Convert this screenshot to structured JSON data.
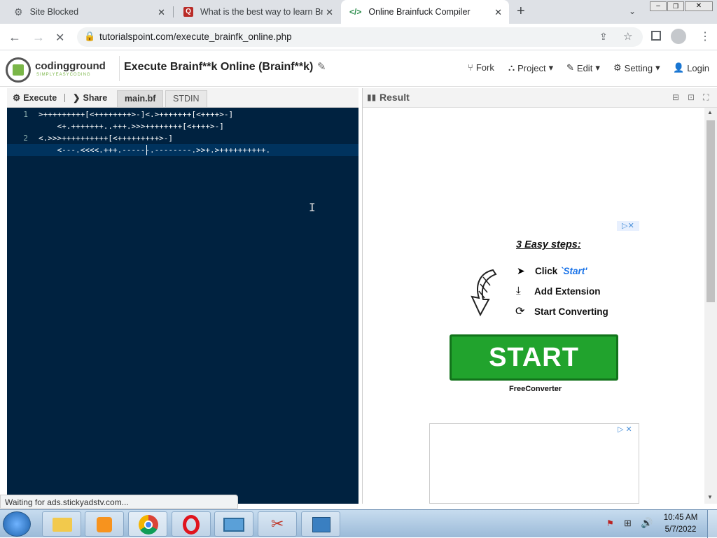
{
  "browser": {
    "tabs": [
      {
        "title": "Site Blocked",
        "icon": "gear-icon"
      },
      {
        "title": "What is the best way to learn Bra",
        "icon": "quora-icon"
      },
      {
        "title": "Online Brainfuck Compiler",
        "icon": "code-icon"
      }
    ],
    "url": "tutorialspoint.com/execute_brainfk_online.php"
  },
  "site": {
    "logo_text": "codingground",
    "logo_tagline": "SIMPLYEASYCODING",
    "page_title": "Execute Brainf**k Online (Brainf**k)",
    "menu": {
      "fork": "Fork",
      "project": "Project",
      "edit": "Edit",
      "setting": "Setting",
      "login": "Login"
    }
  },
  "editor": {
    "execute": "Execute",
    "share": "Share",
    "file_tab": "main.bf",
    "stdin_tab": "STDIN",
    "lines": [
      {
        "num": "1",
        "text": ">+++++++++[<++++++++>-]<.>+++++++[<++++>-]"
      },
      {
        "num": "",
        "text": "    <+.+++++++..+++.>>>++++++++[<++++>-]"
      },
      {
        "num": "2",
        "text": "<.>>>++++++++++[<+++++++++>-]"
      },
      {
        "num": "",
        "text": "    <---.<<<<.+++.------.--------.>>+.>++++++++++."
      }
    ]
  },
  "result": {
    "title": "Result",
    "ad": {
      "heading": "3 Easy steps:",
      "step1_prefix": "Click ",
      "step1_link": "`Start'",
      "step2": "Add Extension",
      "step3": "Start Converting",
      "button": "START",
      "brand": "FreeConverter"
    }
  },
  "status_text": "Waiting for ads.stickyadstv.com...",
  "clock": {
    "time": "10:45 AM",
    "date": "5/7/2022"
  },
  "colors": {
    "editor_bg": "#002240",
    "ad_green": "#21a32d",
    "link_blue": "#1a73e8"
  }
}
